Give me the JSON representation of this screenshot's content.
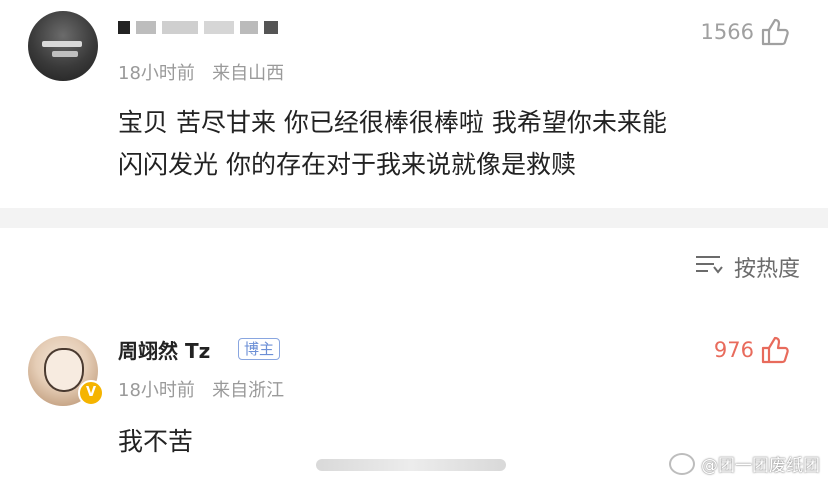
{
  "comments": [
    {
      "username": "",
      "meta": "18小时前   来自山西",
      "likes": "1566",
      "text_line1": "宝贝 苦尽甘来 你已经很棒很棒啦 我希望你未来能",
      "text_line2": "闪闪发光 你的存在对于我来说就像是救赎",
      "liked": false
    },
    {
      "username": "周翊然 Tz",
      "badge": "博主",
      "verified_mark": "V",
      "meta": "18小时前   来自浙江",
      "likes": "976",
      "text": "我不苦",
      "liked": true
    }
  ],
  "sort": {
    "label": "按热度",
    "icon": "sort-lines-icon"
  },
  "watermark": {
    "text": "@团一团废纸团",
    "icon": "weibo-logo-icon"
  },
  "colors": {
    "like_inactive": "#a0a0a0",
    "like_active": "#e86b5c",
    "meta_gray": "#9a9a9a",
    "badge_blue": "#6c8fd6",
    "verified_gold": "#f5b400",
    "band_gray": "#f3f3f3"
  }
}
